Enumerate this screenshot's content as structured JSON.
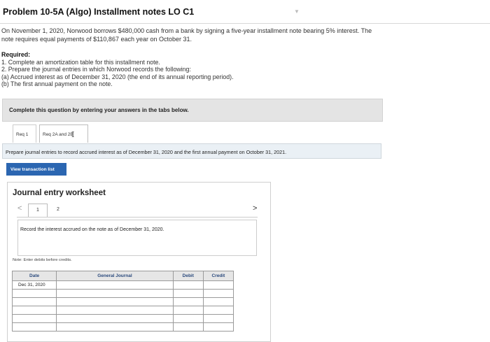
{
  "header": {
    "title": "Problem 10-5A (Algo) Installment notes LO C1"
  },
  "problem": {
    "line1": "On November 1, 2020, Norwood borrows $480,000 cash from a bank by signing a five-year installment note bearing 5% interest. The",
    "line2": "note requires equal payments of $110,867 each year on October 31."
  },
  "required": {
    "heading": "Required:",
    "item1": "1. Complete an amortization table for this installment note.",
    "item2": "2. Prepare the journal entries in which Norwood records the following:",
    "item2a": "(a) Accrued interest as of December 31, 2020 (the end of its annual reporting period).",
    "item2b": "(b) The first annual payment on the note."
  },
  "complete_banner": "Complete this question by entering your answers in the tabs below.",
  "tabs": [
    {
      "label": "Req 1"
    },
    {
      "label": "Req 2A and 2B"
    }
  ],
  "instruction": "Prepare journal entries to record accrued interest as of December 31, 2020 and the first annual payment on October 31, 2021.",
  "view_button": "View transaction list",
  "worksheet": {
    "title": "Journal entry worksheet",
    "prev_symbol": "<",
    "next_symbol": ">",
    "pages": [
      "1",
      "2"
    ],
    "record_text": "Record the interest accrued on the note as of December 31, 2020.",
    "note": "Note: Enter debits before credits."
  },
  "journal": {
    "headers": {
      "date": "Date",
      "general_journal": "General Journal",
      "debit": "Debit",
      "credit": "Credit"
    },
    "first_date": "Dec 31, 2020"
  }
}
